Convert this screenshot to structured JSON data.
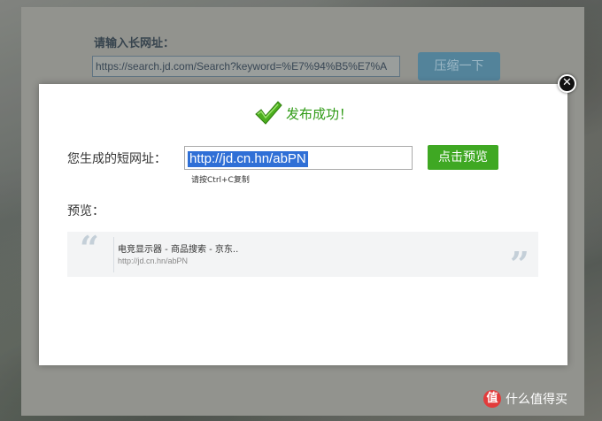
{
  "background": {
    "title": "请输入长网址：",
    "url_value": "https://search.jd.com/Search?keyword=%E7%94%B5%E7%A",
    "compress_label": "压缩一下"
  },
  "modal": {
    "close_symbol": "✕",
    "success_text": "发布成功！",
    "short_label": "您生成的短网址：",
    "short_url": "http://jd.cn.hn/abPN",
    "preview_button": "点击预览",
    "copy_hint": "请按Ctrl+C复制",
    "preview_label": "预览：",
    "preview_card": {
      "quote_open": "“",
      "quote_close": "”",
      "title": "电竞显示器 - 商品搜索 - 京东..",
      "url": "http://jd.cn.hn/abPN"
    }
  },
  "watermark": {
    "badge": "值",
    "text": "什么值得买"
  },
  "colors": {
    "success_green": "#2e9a14",
    "button_green": "#3fa823",
    "selection_blue": "#2f6fd6"
  },
  "icons": [
    "check-icon",
    "close-icon"
  ]
}
